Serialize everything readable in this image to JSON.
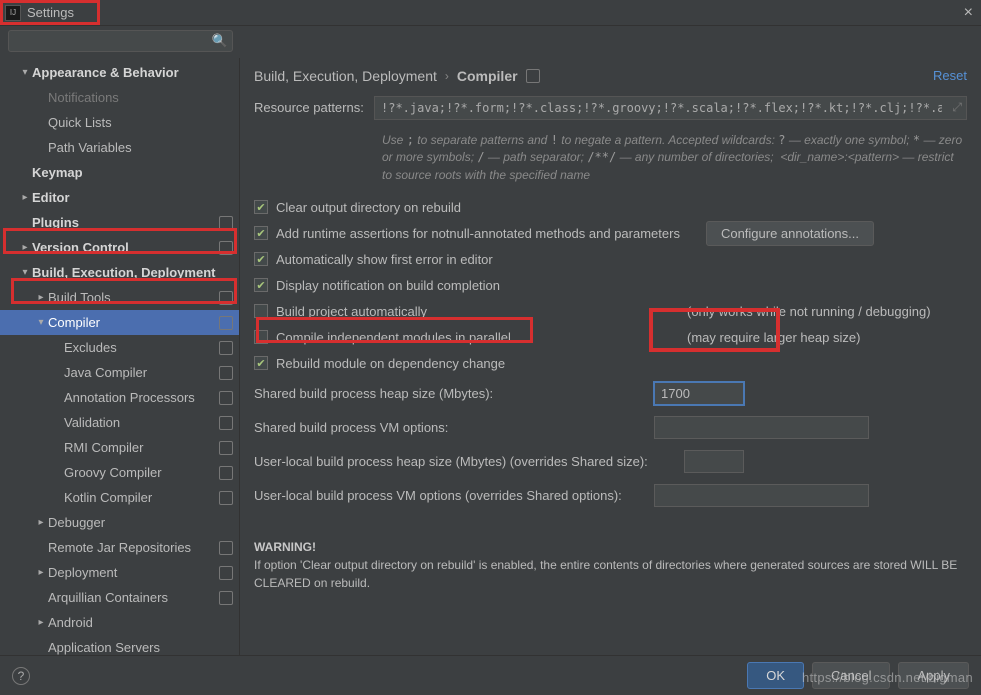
{
  "window": {
    "title": "Settings"
  },
  "search": {
    "placeholder": ""
  },
  "sidebar": {
    "items": [
      {
        "label": "Appearance & Behavior",
        "indent": 1,
        "bold": true,
        "arrow": "down",
        "proj": false
      },
      {
        "label": "Notifications",
        "indent": 2,
        "bold": false,
        "arrow": "",
        "proj": false,
        "dim": true
      },
      {
        "label": "Quick Lists",
        "indent": 2,
        "bold": false,
        "arrow": "",
        "proj": false
      },
      {
        "label": "Path Variables",
        "indent": 2,
        "bold": false,
        "arrow": "",
        "proj": false
      },
      {
        "label": "Keymap",
        "indent": 1,
        "bold": true,
        "arrow": "",
        "proj": false
      },
      {
        "label": "Editor",
        "indent": 1,
        "bold": true,
        "arrow": "right",
        "proj": false
      },
      {
        "label": "Plugins",
        "indent": 1,
        "bold": true,
        "arrow": "",
        "proj": true
      },
      {
        "label": "Version Control",
        "indent": 1,
        "bold": true,
        "arrow": "right",
        "proj": true
      },
      {
        "label": "Build, Execution, Deployment",
        "indent": 1,
        "bold": true,
        "arrow": "down",
        "proj": false
      },
      {
        "label": "Build Tools",
        "indent": 2,
        "bold": false,
        "arrow": "right",
        "proj": true
      },
      {
        "label": "Compiler",
        "indent": 2,
        "bold": false,
        "arrow": "down",
        "proj": true,
        "selected": true
      },
      {
        "label": "Excludes",
        "indent": 3,
        "bold": false,
        "arrow": "",
        "proj": true
      },
      {
        "label": "Java Compiler",
        "indent": 3,
        "bold": false,
        "arrow": "",
        "proj": true
      },
      {
        "label": "Annotation Processors",
        "indent": 3,
        "bold": false,
        "arrow": "",
        "proj": true
      },
      {
        "label": "Validation",
        "indent": 3,
        "bold": false,
        "arrow": "",
        "proj": true
      },
      {
        "label": "RMI Compiler",
        "indent": 3,
        "bold": false,
        "arrow": "",
        "proj": true
      },
      {
        "label": "Groovy Compiler",
        "indent": 3,
        "bold": false,
        "arrow": "",
        "proj": true
      },
      {
        "label": "Kotlin Compiler",
        "indent": 3,
        "bold": false,
        "arrow": "",
        "proj": true
      },
      {
        "label": "Debugger",
        "indent": 2,
        "bold": false,
        "arrow": "right",
        "proj": false
      },
      {
        "label": "Remote Jar Repositories",
        "indent": 2,
        "bold": false,
        "arrow": "",
        "proj": true
      },
      {
        "label": "Deployment",
        "indent": 2,
        "bold": false,
        "arrow": "right",
        "proj": true
      },
      {
        "label": "Arquillian Containers",
        "indent": 2,
        "bold": false,
        "arrow": "",
        "proj": true
      },
      {
        "label": "Android",
        "indent": 2,
        "bold": false,
        "arrow": "right",
        "proj": false
      },
      {
        "label": "Application Servers",
        "indent": 2,
        "bold": false,
        "arrow": "",
        "proj": false
      }
    ]
  },
  "breadcrumb": {
    "a": "Build, Execution, Deployment",
    "b": "Compiler"
  },
  "reset": "Reset",
  "form": {
    "resourcePatternsLabel": "Resource patterns:",
    "resourcePatternsValue": "!?*.java;!?*.form;!?*.class;!?*.groovy;!?*.scala;!?*.flex;!?*.kt;!?*.clj;!?*.aj",
    "helpText": "Use ; to separate patterns and ! to negate a pattern. Accepted wildcards: ? — exactly one symbol; * — zero or more symbols; / — path separator; /**/ — any number of directories; <dir_name>:<pattern> — restrict to source roots with the specified name",
    "checks": {
      "clearOutput": {
        "label": "Clear output directory on rebuild",
        "checked": true
      },
      "addRuntime": {
        "label": "Add runtime assertions for notnull-annotated methods and parameters",
        "checked": true
      },
      "autoFirstError": {
        "label": "Automatically show first error in editor",
        "checked": true
      },
      "displayNotif": {
        "label": "Display notification on build completion",
        "checked": true
      },
      "buildAuto": {
        "label": "Build project automatically",
        "checked": false,
        "note": "(only works while not running / debugging)"
      },
      "compileParallel": {
        "label": "Compile independent modules in parallel",
        "checked": false,
        "note": "(may require larger heap size)"
      },
      "rebuildDep": {
        "label": "Rebuild module on dependency change",
        "checked": true
      }
    },
    "configureBtn": "Configure annotations...",
    "fields": {
      "sharedHeap": {
        "label": "Shared build process heap size (Mbytes):",
        "value": "1700"
      },
      "sharedVm": {
        "label": "Shared build process VM options:",
        "value": ""
      },
      "userHeap": {
        "label": "User-local build process heap size (Mbytes) (overrides Shared size):",
        "value": ""
      },
      "userVm": {
        "label": "User-local build process VM options (overrides Shared options):",
        "value": ""
      }
    },
    "warning": {
      "title": "WARNING!",
      "body": "If option 'Clear output directory on rebuild' is enabled, the entire contents of directories where generated sources are stored WILL BE CLEARED on rebuild."
    }
  },
  "footer": {
    "ok": "OK",
    "cancel": "Cancel",
    "apply": "Apply"
  },
  "watermark": "https://blog.csdn.net/bigman"
}
